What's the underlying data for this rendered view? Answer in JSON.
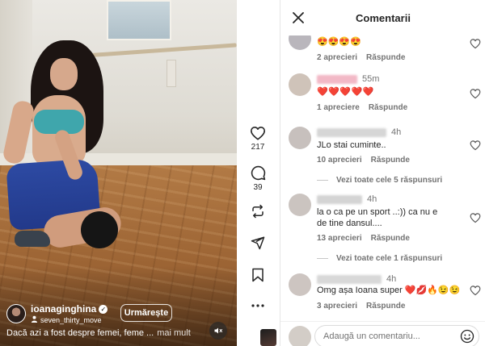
{
  "video": {
    "author": "ioanaginghina",
    "audio": "seven_thirty_move",
    "follow_label": "Urmărește",
    "caption": "Dacă azi a fost despre femei, feme ...",
    "caption_more": "mai mult"
  },
  "rail": {
    "likes": "217",
    "comments": "39"
  },
  "panel": {
    "title": "Comentarii",
    "comments": [
      {
        "text": "😍😍😍😍",
        "time": "",
        "likes": "2 aprecieri",
        "reply": "Răspunde"
      },
      {
        "text": "❤️❤️❤️❤️❤️",
        "time": "55m",
        "likes": "1 apreciere",
        "reply": "Răspunde"
      },
      {
        "text": "JLo stai cuminte..",
        "time": "4h",
        "likes": "10 aprecieri",
        "reply": "Răspunde",
        "view_replies": "Vezi toate cele 5 răspunsuri"
      },
      {
        "text": "la o ca pe un sport ..:)) ca nu e de tine dansul....",
        "time": "4h",
        "likes": "13 aprecieri",
        "reply": "Răspunde",
        "view_replies": "Vezi toate cele 1 răspunsuri"
      },
      {
        "text": "Omg așa Ioana super ❤️💋🔥😉😉",
        "time": "4h",
        "likes": "3 aprecieri",
        "reply": "Răspunde"
      }
    ],
    "composer_placeholder": "Adaugă un comentariu..."
  },
  "colors": {
    "accent": "#262626",
    "muted": "#737373",
    "heart_red": "#e0245e",
    "skirt_blue": "#2d4aa3",
    "top_teal": "#3fa6ac"
  },
  "icons": [
    "close-icon",
    "heart-icon",
    "comment-icon",
    "share-icon",
    "send-icon",
    "bookmark-icon",
    "more-icon",
    "mute-icon",
    "verified-icon",
    "person-icon",
    "emoji-icon"
  ]
}
